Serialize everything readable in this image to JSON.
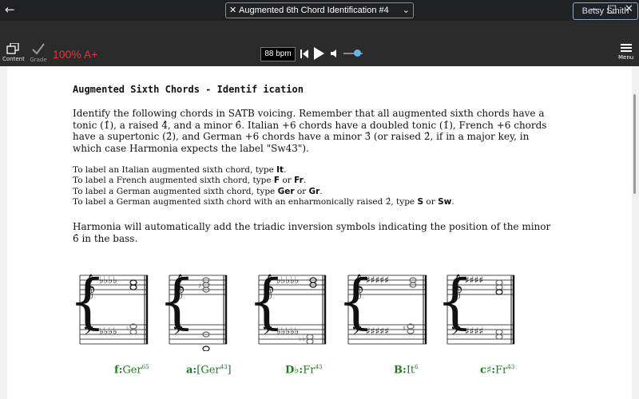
{
  "window": {
    "back_icon": "arrow-left-icon"
  },
  "header": {
    "title": "Augmented 6th Chord Identification #4 (100%)",
    "user": "Betsy Smith",
    "content_label": "Content",
    "grade_label": "Grade",
    "score": "100% A+",
    "tempo": "88 bpm",
    "menu_label": "Menu",
    "colors": {
      "score": "#e8323a",
      "accent": "#61b6f0"
    }
  },
  "document": {
    "heading": "Augmented Sixth Chords - Identif ication",
    "intro": "Identify the following chords in SATB voicing. Remember that all augmented sixth chords have a tonic (1̂), a raised 4̂, and a minor 6̂. Italian +6 chords have a doubled tonic (1̂), French +6 chords have a supertonic (2̂), and German +6 chords have a minor 3̂ (or raised 2̂, if in a major key, in which case Harmonia expects the label \"Sw43\").",
    "instructions": [
      {
        "text": "To label an Italian augmented sixth chord, type ",
        "code": "It",
        "tail": "."
      },
      {
        "text": "To label a French augmented sixth chord, type ",
        "code": "F",
        "mid": " or ",
        "code2": "Fr",
        "tail": "."
      },
      {
        "text": "To label a German augmented sixth chord, type ",
        "code": "Ger",
        "mid": " or ",
        "code2": "Gr",
        "tail": "."
      },
      {
        "text": "To label a German augmented sixth chord with an enharmonically raised 2̂, type ",
        "code": "S",
        "mid": " or ",
        "code2": "Sw",
        "tail": "."
      }
    ],
    "auto_note": "Harmonia will automatically add the triadic inversion symbols indicating the position of the minor 6̂ in the bass."
  },
  "answers": [
    {
      "key": "f:",
      "chord": "Ger",
      "fig_top": "6",
      "fig_bot": "5",
      "bracket": false
    },
    {
      "key": "a:",
      "chord": "Ger",
      "fig_top": "4",
      "fig_bot": "3",
      "bracket": true
    },
    {
      "key": "D♭:",
      "chord": "Fr",
      "fig_top": "4",
      "fig_bot": "3",
      "bracket": false
    },
    {
      "key": "B:",
      "chord": "It",
      "fig_top": "6",
      "fig_bot": "",
      "bracket": false
    },
    {
      "key": "c♯:",
      "chord": "Fr",
      "fig_top": "4",
      "fig_bot": "3",
      "bracket": false
    }
  ]
}
